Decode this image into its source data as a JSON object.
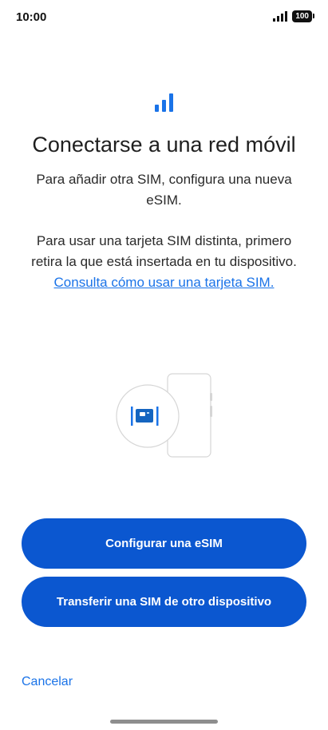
{
  "status_bar": {
    "time": "10:00",
    "battery": "100",
    "signal_icon": "signal-bars-icon"
  },
  "header": {
    "icon": "mobile-signal-icon",
    "title": "Conectarse a una red móvil"
  },
  "body": {
    "paragraph1": "Para añadir otra SIM, configura una nueva eSIM.",
    "paragraph2_text": "Para usar una tarjeta SIM distinta, primero retira la que está insertada en tu dispositivo. ",
    "paragraph2_link": "Consulta cómo usar una tarjeta SIM."
  },
  "illustration": {
    "icon": "sim-card-phone-illustration"
  },
  "actions": {
    "configure_esim": "Configurar una eSIM",
    "transfer_sim": "Transferir una SIM de otro dispositivo",
    "cancel": "Cancelar"
  },
  "colors": {
    "accent": "#0b57d0",
    "link": "#1a73e8"
  }
}
